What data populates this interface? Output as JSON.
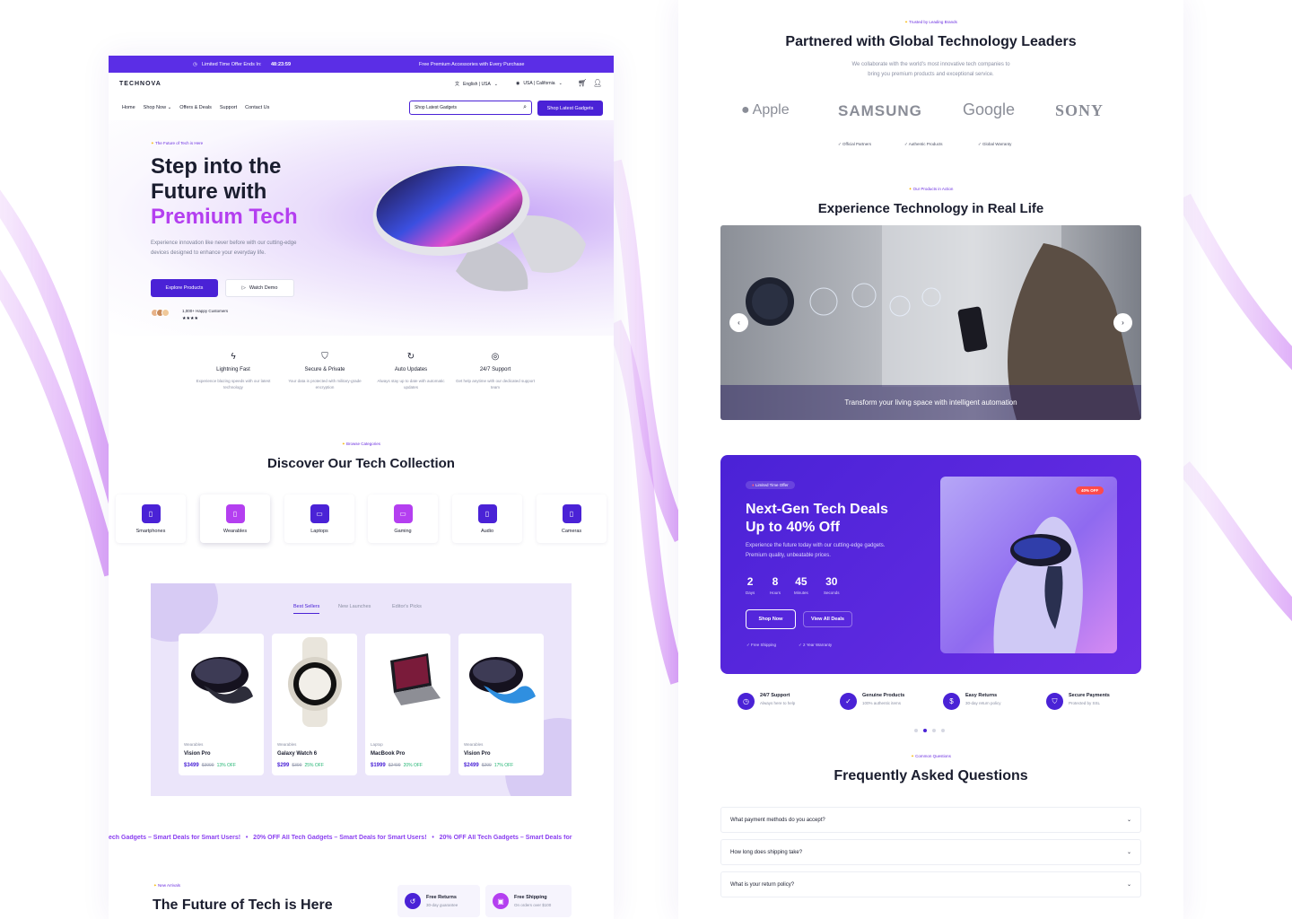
{
  "brand": "TECHNOVA",
  "colors": {
    "primary": "#4a22d6",
    "accent": "#b43ff0",
    "banner": "#5b2ee6"
  },
  "topbar": {
    "offer_label": "Limited Time Offer Ends In:",
    "timer": "48:23:59",
    "promo": "Free Premium Accessories with Every Purchase"
  },
  "header": {
    "language": "English | USA",
    "region": "USA | California"
  },
  "nav": {
    "items": [
      "Home",
      "Shop Now",
      "Offers & Deals",
      "Support",
      "Contact Us"
    ],
    "search_placeholder": "Shop Latest Gadgets",
    "cta": "Shop Latest Gadgets"
  },
  "hero": {
    "eyebrow": "The Future of Tech is Here",
    "title_line1": "Step into the",
    "title_line2": "Future with",
    "title_highlight": "Premium Tech",
    "description": "Experience innovation like never before with our cutting-edge devices designed to enhance your everyday life.",
    "primary_button": "Explore Products",
    "secondary_button": "Watch Demo",
    "customers": "1,000+ Happy Customers",
    "stars": "★★★★"
  },
  "features": [
    {
      "icon": "lightning-icon",
      "title": "Lightning Fast",
      "desc": "Experience blazing speeds with our latest technology"
    },
    {
      "icon": "shield-icon",
      "title": "Secure & Private",
      "desc": "Your data is protected with military-grade encryption"
    },
    {
      "icon": "refresh-icon",
      "title": "Auto Updates",
      "desc": "Always stay up to date with automatic updates"
    },
    {
      "icon": "support-icon",
      "title": "24/7 Support",
      "desc": "Get help anytime with our dedicated support team"
    }
  ],
  "categories_section": {
    "eyebrow": "Browse Categories",
    "title": "Discover Our Tech Collection",
    "items": [
      "Smartphones",
      "Wearables",
      "Laptops",
      "Gaming",
      "Audio",
      "Cameras"
    ]
  },
  "products_section": {
    "tabs": [
      "Best Sellers",
      "New Launches",
      "Editor's Picks"
    ],
    "products": [
      {
        "category": "Wearables",
        "name": "Vision Pro",
        "price": "$3499",
        "old": "$3999",
        "off": "13% OFF"
      },
      {
        "category": "Wearables",
        "name": "Galaxy Watch 6",
        "price": "$299",
        "old": "$399",
        "off": "25% OFF"
      },
      {
        "category": "Laptop",
        "name": "MacBook Pro",
        "price": "$1999",
        "old": "$2499",
        "off": "20% OFF"
      },
      {
        "category": "Wearables",
        "name": "Vision Pro",
        "price": "$2499",
        "old": "$299",
        "off": "17% OFF"
      }
    ]
  },
  "marquee": {
    "text": "ech Gadgets – Smart Deals for Smart Users!   •   20% OFF All Tech Gadgets – Smart Deals for Smart Users!   •   20% OFF All Tech Gadgets – Smart Deals for"
  },
  "arrivals": {
    "eyebrow": "New Arrivals",
    "title": "The Future of Tech is Here",
    "badges": [
      {
        "title": "Free Returns",
        "desc": "30-day guarantee"
      },
      {
        "title": "Free Shipping",
        "desc": "On orders over $100"
      }
    ]
  },
  "partners": {
    "eyebrow": "Trusted by Leading Brands",
    "title": "Partnered with Global Technology Leaders",
    "description_line1": "We collaborate with the world's most innovative tech companies to",
    "description_line2": "bring you premium products and exceptional service.",
    "logos": [
      "Apple",
      "SAMSUNG",
      "Google",
      "SONY"
    ],
    "checks": [
      "Official Partners",
      "Authentic Products",
      "Global Warranty"
    ]
  },
  "action": {
    "eyebrow": "Our Products in Action",
    "title": "Experience Technology in Real Life",
    "caption": "Transform your living space with intelligent automation"
  },
  "deal": {
    "badge": "Limited Time Offer",
    "title_line1": "Next-Gen Tech Deals",
    "title_line2": "Up to 40% Off",
    "description": "Experience the future today with our cutting-edge gadgets. Premium quality, unbeatable prices.",
    "countdown": [
      {
        "n": "2",
        "u": "Days"
      },
      {
        "n": "8",
        "u": "Hours"
      },
      {
        "n": "45",
        "u": "Minutes"
      },
      {
        "n": "30",
        "u": "Seconds"
      }
    ],
    "shop_button": "Shop Now",
    "view_button": "View All Deals",
    "perks": [
      "Free Shipping",
      "2 Year Warranty"
    ],
    "discount": "40% OFF"
  },
  "trust": [
    {
      "title": "24/7 Support",
      "desc": "Always here to help"
    },
    {
      "title": "Genuine Products",
      "desc": "100% authentic items"
    },
    {
      "title": "Easy Returns",
      "desc": "30-day return policy"
    },
    {
      "title": "Secure Payments",
      "desc": "Protected by SSL"
    }
  ],
  "faq": {
    "eyebrow": "Common Questions",
    "title": "Frequently Asked Questions",
    "items": [
      "What payment methods do you accept?",
      "How long does shipping take?",
      "What is your return policy?"
    ]
  }
}
